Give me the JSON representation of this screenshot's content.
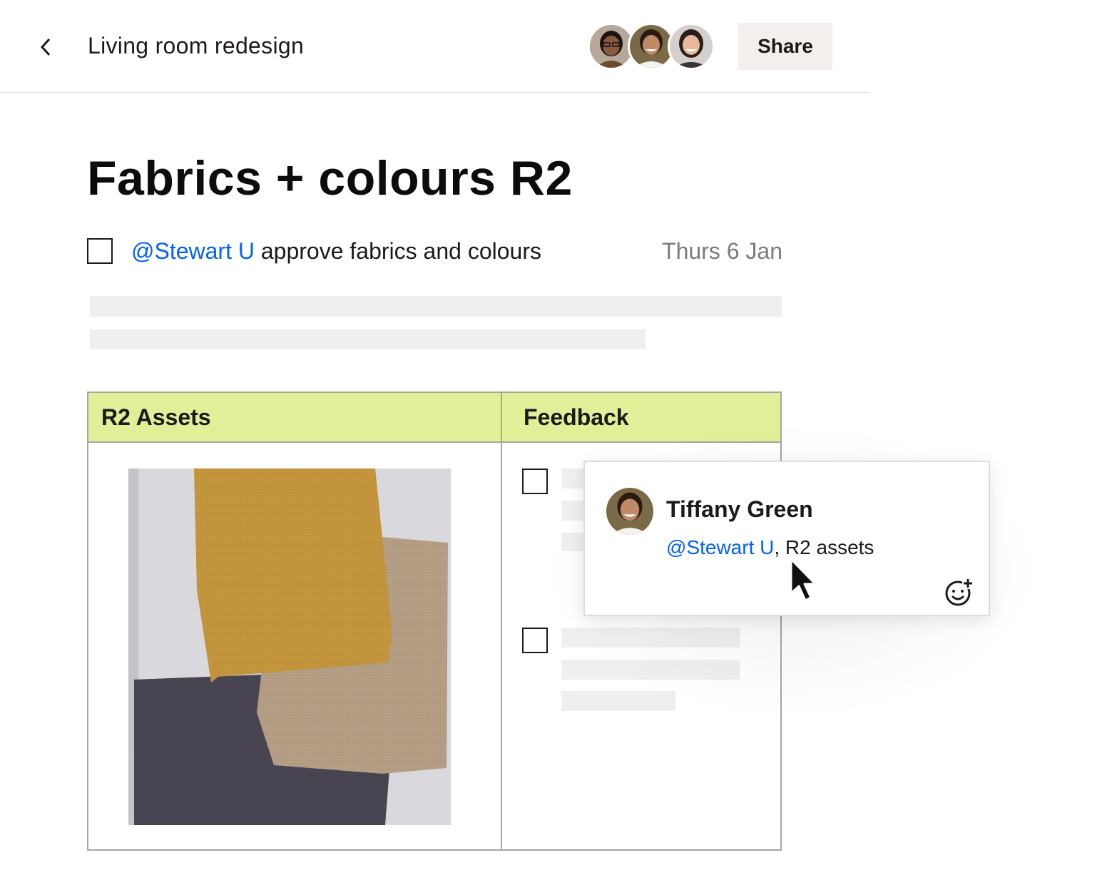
{
  "header": {
    "doc_title": "Living room redesign",
    "share_label": "Share",
    "collaborators": [
      {
        "avatar": "person-1-avatar",
        "skin": "#8a5a3c",
        "hair": "#1a1412",
        "bg": "#b7a89a"
      },
      {
        "avatar": "person-2-avatar",
        "skin": "#c08a66",
        "hair": "#2a1a12",
        "bg": "#7a6a48"
      },
      {
        "avatar": "person-3-avatar",
        "skin": "#e6b99c",
        "hair": "#2a1c16",
        "bg": "#d6d0cc"
      }
    ]
  },
  "page": {
    "title": "Fabrics + colours R2"
  },
  "task": {
    "mention": "@Stewart U",
    "text": " approve fabrics and colours",
    "date": "Thurs 6 Jan"
  },
  "table": {
    "col_assets": "R2 Assets",
    "col_feedback": "Feedback"
  },
  "comment": {
    "author": "Tiffany Green",
    "mention": "@Stewart U",
    "text": ", R2 assets"
  },
  "colors": {
    "accent": "#0061fe",
    "table_header": "#dff098",
    "share_bg": "#f2efec"
  },
  "icons": {
    "back": "chevron-left-icon",
    "add_reaction": "add-emoji-icon",
    "pointer": "mouse-cursor-icon"
  }
}
